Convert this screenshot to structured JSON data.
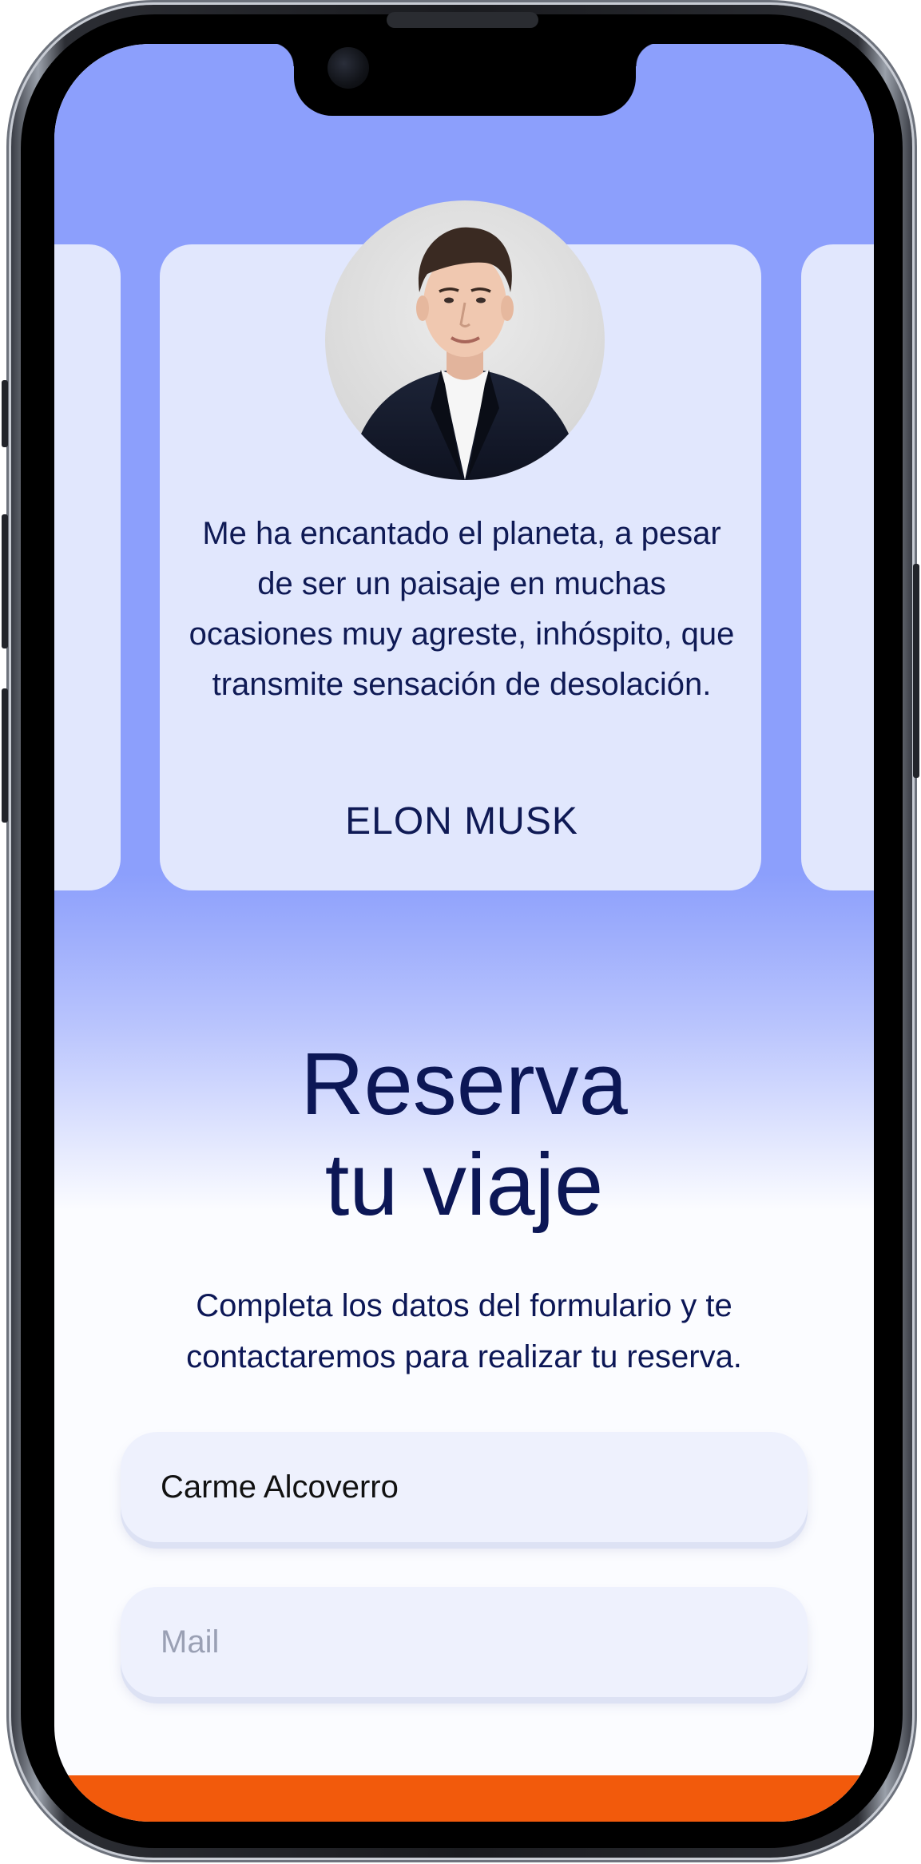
{
  "testimonial": {
    "quote": "Me ha encantado el planeta, a pesar de ser un paisaje en muchas ocasiones muy agreste, inhóspito, que transmite sensación de desolación.",
    "author": "ELON MUSK"
  },
  "booking": {
    "title_line1": "Reserva",
    "title_line2": "tu viaje",
    "description": "Completa los datos del formulario y te contactaremos para realizar tu reserva.",
    "name_value": "Carme Alcoverro",
    "mail_placeholder": "Mail"
  },
  "colors": {
    "hero_bg": "#8c9ffc",
    "card_bg": "#e1e7fd",
    "text_dark": "#0c1756",
    "accent_orange": "#f25a0c",
    "field_bg": "#eef1fd"
  }
}
